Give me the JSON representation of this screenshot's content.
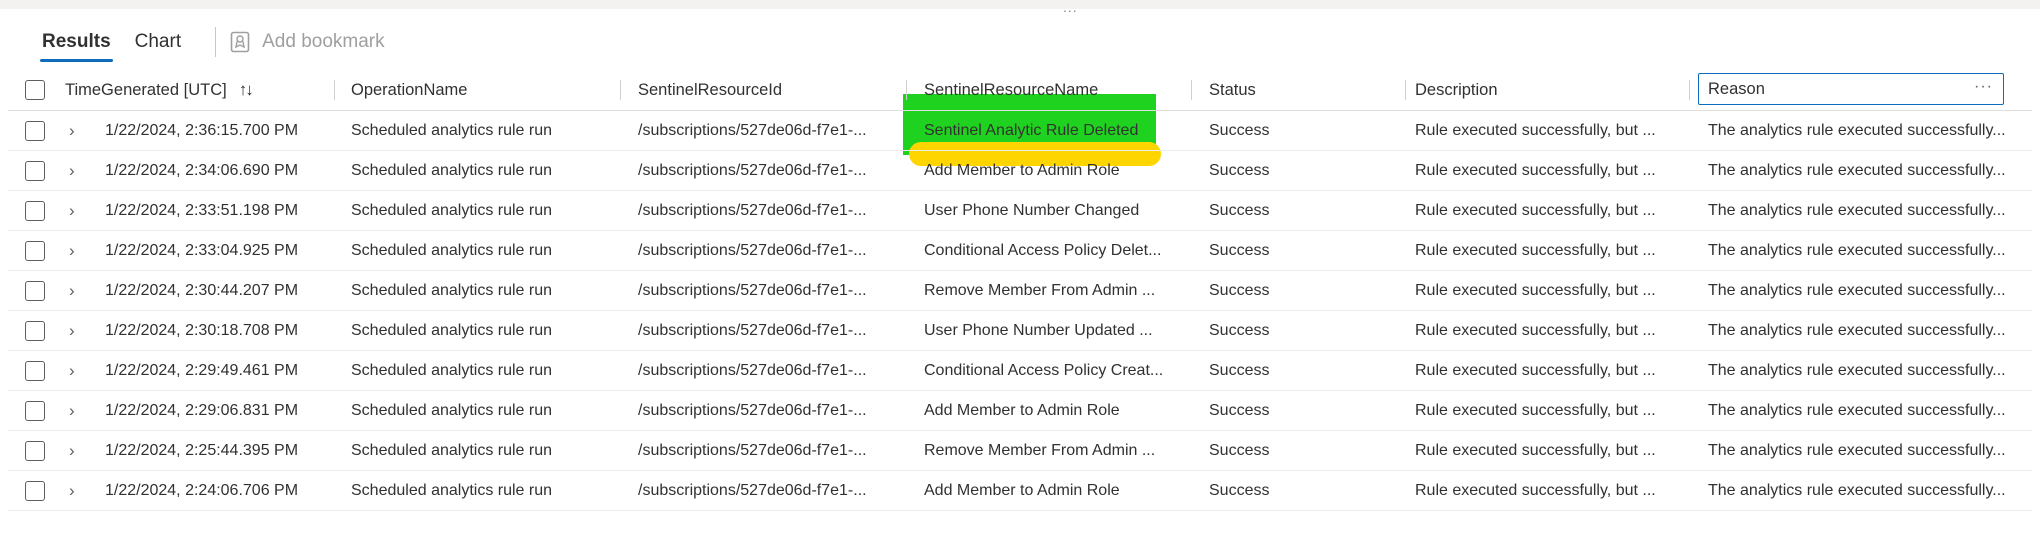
{
  "tabs": [
    {
      "label": "Results",
      "active": true
    },
    {
      "label": "Chart",
      "active": false
    }
  ],
  "toolbar": {
    "add_bookmark_label": "Add bookmark",
    "grip": "..."
  },
  "columns": {
    "time": "TimeGenerated [UTC]",
    "operation": "OperationName",
    "resource_id": "SentinelResourceId",
    "resource_name": "SentinelResourceName",
    "status": "Status",
    "description": "Description",
    "reason": "Reason"
  },
  "sort_icon": "↑↓",
  "more_icon": "···",
  "rows": [
    {
      "time": "1/22/2024, 2:36:15.700 PM",
      "operation": "Scheduled analytics rule run",
      "resource_id": "/subscriptions/527de06d-f7e1-...",
      "resource_name": "Sentinel Analytic Rule Deleted",
      "status": "Success",
      "description": "Rule executed successfully, but ...",
      "reason": "The analytics rule executed successfully..."
    },
    {
      "time": "1/22/2024, 2:34:06.690 PM",
      "operation": "Scheduled analytics rule run",
      "resource_id": "/subscriptions/527de06d-f7e1-...",
      "resource_name": "Add Member to Admin Role",
      "status": "Success",
      "description": "Rule executed successfully, but ...",
      "reason": "The analytics rule executed successfully..."
    },
    {
      "time": "1/22/2024, 2:33:51.198 PM",
      "operation": "Scheduled analytics rule run",
      "resource_id": "/subscriptions/527de06d-f7e1-...",
      "resource_name": "User Phone Number Changed",
      "status": "Success",
      "description": "Rule executed successfully, but ...",
      "reason": "The analytics rule executed successfully..."
    },
    {
      "time": "1/22/2024, 2:33:04.925 PM",
      "operation": "Scheduled analytics rule run",
      "resource_id": "/subscriptions/527de06d-f7e1-...",
      "resource_name": "Conditional Access Policy Delet...",
      "status": "Success",
      "description": "Rule executed successfully, but ...",
      "reason": "The analytics rule executed successfully..."
    },
    {
      "time": "1/22/2024, 2:30:44.207 PM",
      "operation": "Scheduled analytics rule run",
      "resource_id": "/subscriptions/527de06d-f7e1-...",
      "resource_name": "Remove Member From Admin ...",
      "status": "Success",
      "description": "Rule executed successfully, but ...",
      "reason": "The analytics rule executed successfully..."
    },
    {
      "time": "1/22/2024, 2:30:18.708 PM",
      "operation": "Scheduled analytics rule run",
      "resource_id": "/subscriptions/527de06d-f7e1-...",
      "resource_name": "User Phone Number Updated ...",
      "status": "Success",
      "description": "Rule executed successfully, but ...",
      "reason": "The analytics rule executed successfully..."
    },
    {
      "time": "1/22/2024, 2:29:49.461 PM",
      "operation": "Scheduled analytics rule run",
      "resource_id": "/subscriptions/527de06d-f7e1-...",
      "resource_name": "Conditional Access Policy Creat...",
      "status": "Success",
      "description": "Rule executed successfully, but ...",
      "reason": "The analytics rule executed successfully..."
    },
    {
      "time": "1/22/2024, 2:29:06.831 PM",
      "operation": "Scheduled analytics rule run",
      "resource_id": "/subscriptions/527de06d-f7e1-...",
      "resource_name": "Add Member to Admin Role",
      "status": "Success",
      "description": "Rule executed successfully, but ...",
      "reason": "The analytics rule executed successfully..."
    },
    {
      "time": "1/22/2024, 2:25:44.395 PM",
      "operation": "Scheduled analytics rule run",
      "resource_id": "/subscriptions/527de06d-f7e1-...",
      "resource_name": "Remove Member From Admin ...",
      "status": "Success",
      "description": "Rule executed successfully, but ...",
      "reason": "The analytics rule executed successfully..."
    },
    {
      "time": "1/22/2024, 2:24:06.706 PM",
      "operation": "Scheduled analytics rule run",
      "resource_id": "/subscriptions/527de06d-f7e1-...",
      "resource_name": "Add Member to Admin Role",
      "status": "Success",
      "description": "Rule executed successfully, but ...",
      "reason": "The analytics rule executed successfully..."
    }
  ],
  "annotation": {
    "highlight_color": "#1fd21f",
    "underline_color": "#ffd500"
  },
  "colors": {
    "accent": "#0f6cbd"
  }
}
